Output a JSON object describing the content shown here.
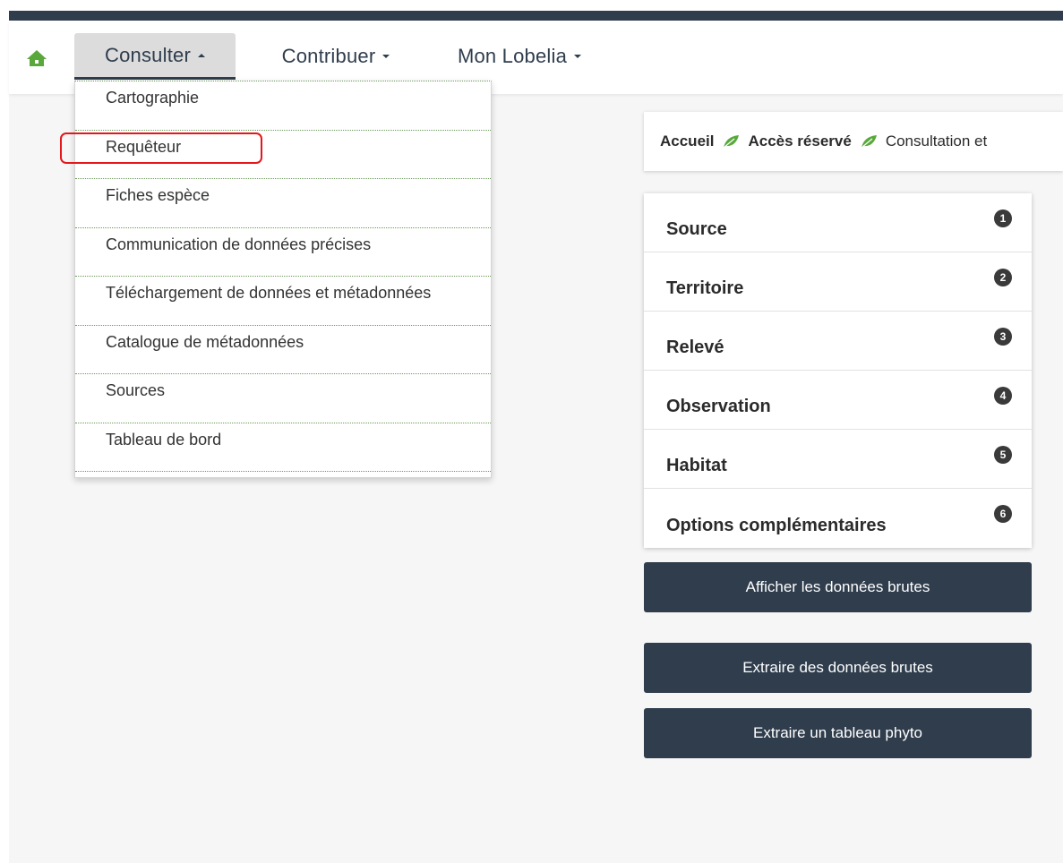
{
  "navbar": {
    "home_icon": "home-icon",
    "menus": [
      {
        "label": "Consulter",
        "open": true
      },
      {
        "label": "Contribuer",
        "open": false
      },
      {
        "label": "Mon Lobelia",
        "open": false
      }
    ]
  },
  "dropdown": {
    "items": [
      {
        "label": "Cartographie"
      },
      {
        "label": "Requêteur",
        "highlighted": true
      },
      {
        "label": "Fiches espèce"
      },
      {
        "label": "Communication de données précises"
      },
      {
        "label": "Téléchargement de données et métadonnées"
      },
      {
        "label": "Catalogue de métadonnées"
      },
      {
        "label": "Sources"
      },
      {
        "label": "Tableau de bord"
      }
    ]
  },
  "breadcrumb": {
    "items": [
      "Accueil",
      "Accès réservé",
      "Consultation et"
    ],
    "separator_icon": "leaf-icon"
  },
  "query_panel": {
    "sections": [
      {
        "label": "Source",
        "number": "1"
      },
      {
        "label": "Territoire",
        "number": "2"
      },
      {
        "label": "Relevé",
        "number": "3"
      },
      {
        "label": "Observation",
        "number": "4"
      },
      {
        "label": "Habitat",
        "number": "5"
      },
      {
        "label": "Options complémentaires",
        "number": "6"
      }
    ]
  },
  "buttons": {
    "show_raw": "Afficher les données brutes",
    "extract_raw": "Extraire des données brutes",
    "extract_phyto": "Extraire un tableau phyto"
  },
  "colors": {
    "navbar_dark": "#2f3d4d",
    "accent_green": "#5aa83c",
    "highlight_red": "#e3171c",
    "page_background": "#f6f6f6"
  }
}
